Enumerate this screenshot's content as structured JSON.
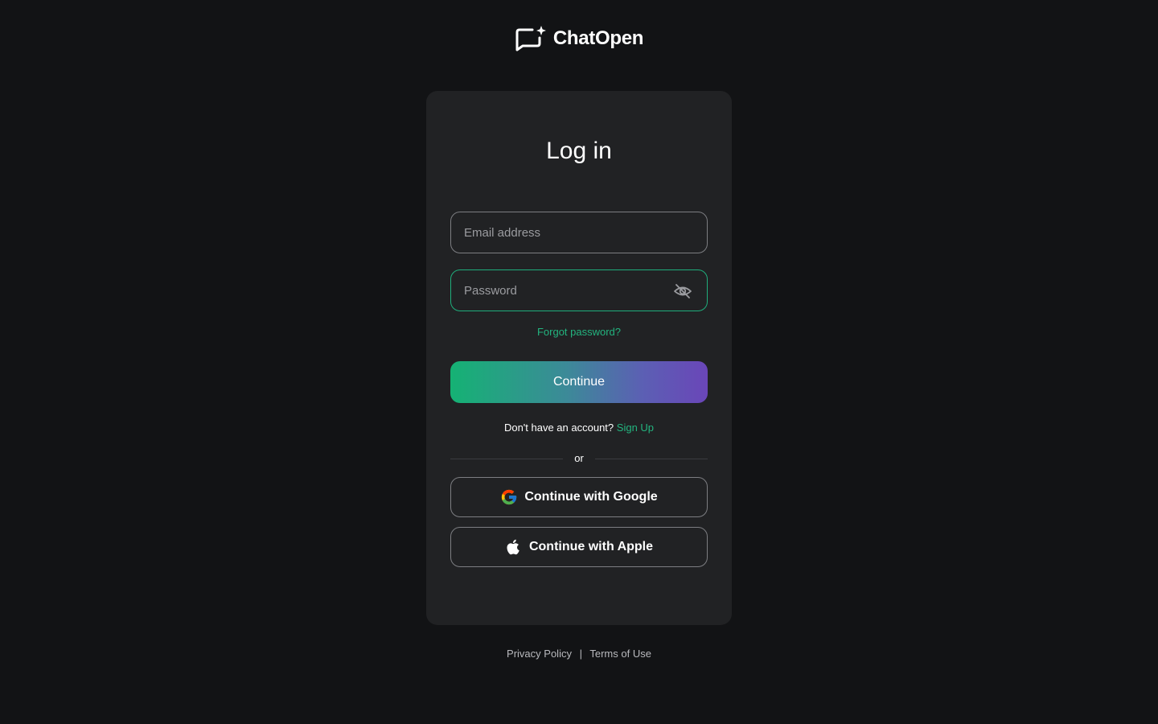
{
  "brand": {
    "name": "ChatOpen",
    "logo_icon": "chat-sparkle-icon"
  },
  "login": {
    "title": "Log in",
    "email_placeholder": "Email address",
    "email_value": "",
    "password_placeholder": "Password",
    "password_value": "",
    "password_toggle_icon": "eye-off-icon",
    "forgot_password": "Forgot password?",
    "continue_label": "Continue",
    "no_account_text": "Don't have an account?",
    "signup_label": "Sign Up",
    "divider_text": "or"
  },
  "social": {
    "google_label": "Continue with Google",
    "google_icon": "google-icon",
    "apple_label": "Continue with Apple",
    "apple_icon": "apple-icon"
  },
  "footer": {
    "privacy": "Privacy Policy",
    "separator": "|",
    "terms": "Terms of Use"
  },
  "colors": {
    "background": "#121315",
    "card": "#212224",
    "accent": "#23b47f",
    "gradient_start": "#15b274",
    "gradient_end": "#6a46b8"
  }
}
